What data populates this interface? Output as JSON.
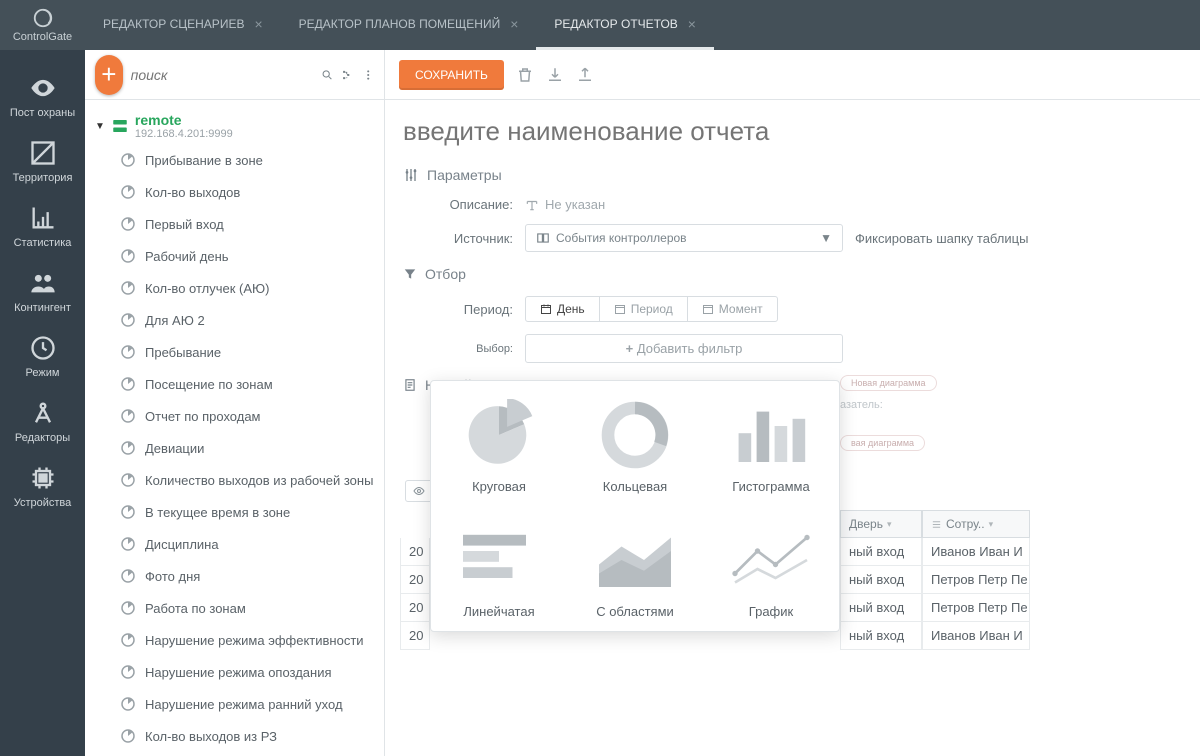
{
  "brand": "ControlGate",
  "tabs": [
    {
      "label": "РЕДАКТОР СЦЕНАРИЕВ",
      "active": false
    },
    {
      "label": "РЕДАКТОР ПЛАНОВ ПОМЕЩЕНИЙ",
      "active": false
    },
    {
      "label": "РЕДАКТОР ОТЧЕТОВ",
      "active": true
    }
  ],
  "nav": {
    "post": "Пост охраны",
    "territory": "Территория",
    "stats": "Статистика",
    "contingent": "Контингент",
    "mode": "Режим",
    "editors": "Редакторы",
    "devices": "Устройства"
  },
  "search_placeholder": "поиск",
  "server": {
    "name": "remote",
    "ip": "192.168.4.201:9999"
  },
  "reports": [
    "Прибывание в зоне",
    "Кол-во выходов",
    "Первый вход",
    "Рабочий день",
    "Кол-во отлучек (АЮ)",
    "Для АЮ 2",
    "Пребывание",
    "Посещение по зонам",
    "Отчет по проходам",
    "Девиации",
    "Количество выходов из рабочей зоны",
    "В текущее время в зоне",
    "Дисциплина",
    "Фото дня",
    "Работа по зонам",
    "Нарушение режима эффективности",
    "Нарушение режима опоздания",
    "Нарушение режима ранний уход",
    "Кол-во выходов из РЗ"
  ],
  "main": {
    "save": "СОХРАНИТЬ",
    "title_placeholder": "введите наименование отчета",
    "params": "Параметры",
    "desc_label": "Описание:",
    "desc_val": "Не указан",
    "src_label": "Источник:",
    "src_val": "События контроллеров",
    "fix_header": "Фиксировать шапку таблицы",
    "filter": "Отбор",
    "period_label": "Период:",
    "seg_day": "День",
    "seg_period": "Период",
    "seg_moment": "Момент",
    "choice_label": "Выбор:",
    "add_filter": "Добавить фильтр",
    "data_setup": "Настойка данных"
  },
  "charts": {
    "pie": "Круговая",
    "donut": "Кольцевая",
    "hist": "Гистограмма",
    "hbar": "Линейчатая",
    "area": "С областями",
    "line": "График"
  },
  "bg": {
    "new_diagram": "Новая диаграмма",
    "indicator": "азатель:",
    "new_diagram2": "вая диаграмма"
  },
  "table": {
    "cols": [
      "20",
      "ный вход",
      "Дверь",
      "Сотру.."
    ],
    "partial_year": "20",
    "door": "ный вход",
    "rows": [
      {
        "y": "20",
        "d": "ный вход",
        "p": "Иванов Иван И"
      },
      {
        "y": "20",
        "d": "ный вход",
        "p": "Петров Петр Пе"
      },
      {
        "y": "20",
        "d": "ный вход",
        "p": "Петров Петр Пе"
      },
      {
        "y": "20",
        "d": "ный вход",
        "p": "Иванов Иван И"
      }
    ]
  }
}
